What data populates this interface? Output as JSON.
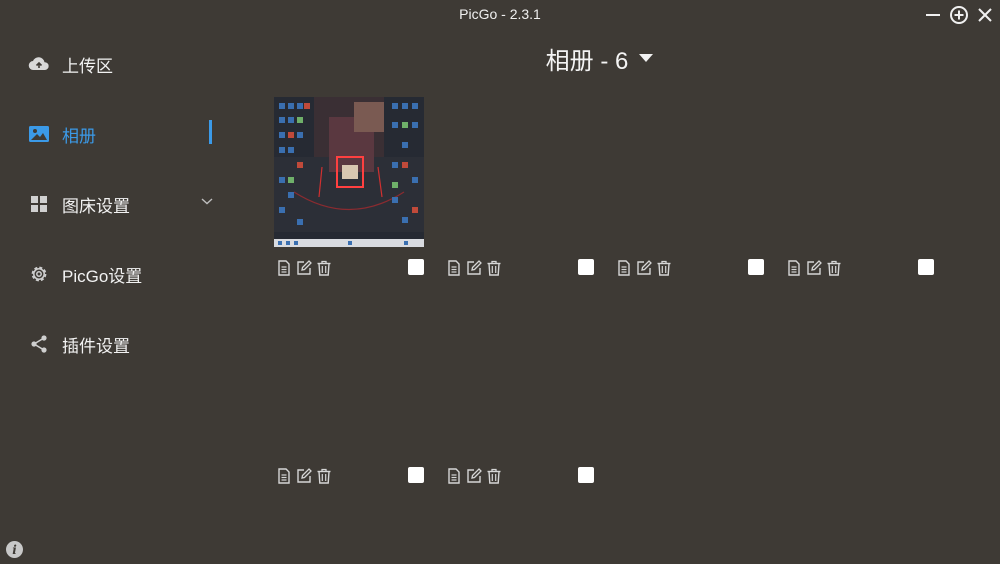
{
  "window": {
    "title": "PicGo - 2.3.1"
  },
  "sidebar": {
    "items": [
      {
        "label": "上传区",
        "icon": "cloud-upload-icon"
      },
      {
        "label": "相册",
        "icon": "image-icon",
        "active": true
      },
      {
        "label": "图床设置",
        "icon": "grid-icon",
        "expandable": true
      },
      {
        "label": "PicGo设置",
        "icon": "gear-icon"
      },
      {
        "label": "插件设置",
        "icon": "share-icon"
      }
    ]
  },
  "gallery": {
    "title": "相册 - 6",
    "card_count": 6
  },
  "footer": {
    "info_icon_glyph": "i"
  },
  "colors": {
    "background": "#3e3a35",
    "accent": "#3b9ae8",
    "text": "#f2f2f2"
  }
}
